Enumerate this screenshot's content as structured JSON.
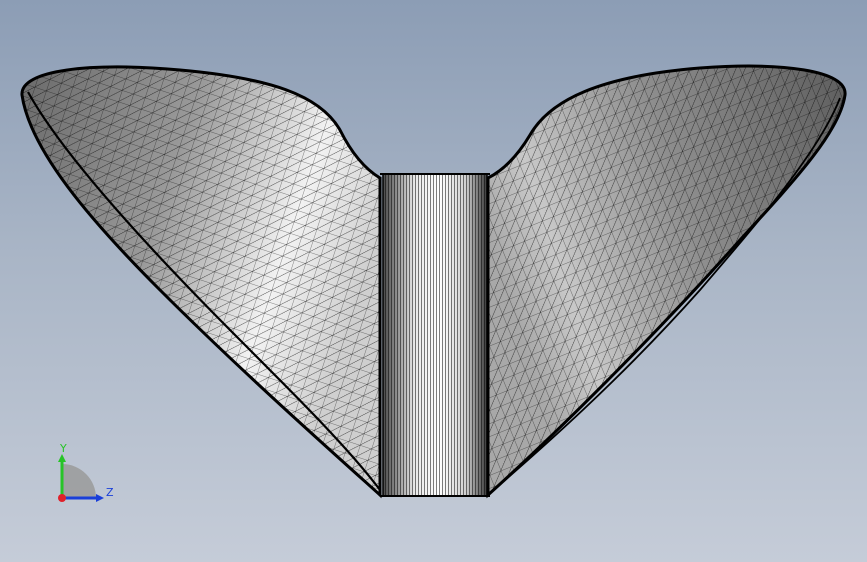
{
  "viewport": {
    "background_top": "#8c9db5",
    "background_bottom": "#c5ccd8"
  },
  "model": {
    "render_style": "wireframe-mesh",
    "edge_color": "#000000",
    "face_light": "#f4f4f4",
    "face_dark": "#5a5a5a"
  },
  "triad": {
    "y_label": "Y",
    "z_label": "Z",
    "y_color": "#27c427",
    "z_color": "#1a3fd9",
    "origin_color": "#e0202a"
  }
}
